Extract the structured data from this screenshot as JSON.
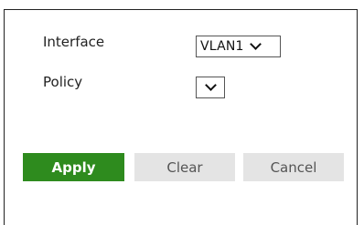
{
  "form": {
    "interface_label": "Interface",
    "interface_value": "VLAN1",
    "policy_label": "Policy",
    "policy_value": ""
  },
  "buttons": {
    "apply": "Apply",
    "clear": "Clear",
    "cancel": "Cancel"
  },
  "colors": {
    "apply_bg": "#2e8b1e",
    "secondary_bg": "#e4e4e4"
  },
  "icons": {
    "dropdown": "chevron-down-icon"
  }
}
